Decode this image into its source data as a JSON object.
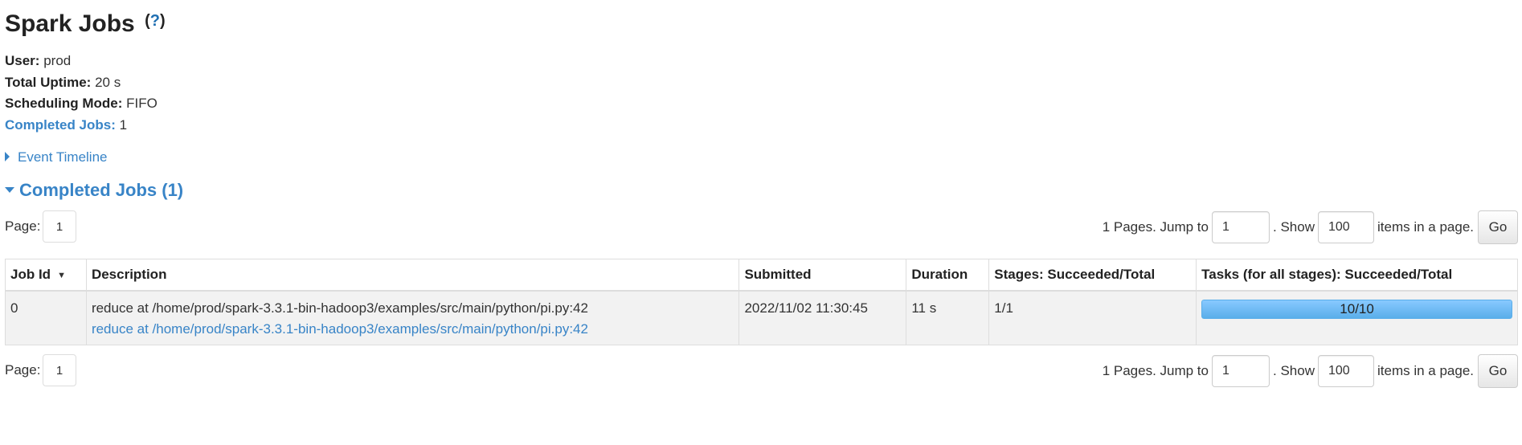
{
  "header": {
    "title": "Spark Jobs",
    "help_open": "(",
    "help_q": "?",
    "help_close": ")"
  },
  "summary": {
    "user_label": "User:",
    "user_value": "prod",
    "uptime_label": "Total Uptime:",
    "uptime_value": "20 s",
    "scheduling_label": "Scheduling Mode:",
    "scheduling_value": "FIFO",
    "completed_label": "Completed Jobs:",
    "completed_value": "1"
  },
  "event_timeline": "Event Timeline",
  "completed_section": "Completed Jobs (1)",
  "pager": {
    "page_label": "Page:",
    "page_current": "1",
    "pages_text": "1 Pages. Jump to",
    "jump_value": "1",
    "show_text": ". Show",
    "show_value": "100",
    "items_text": "items in a page.",
    "go_label": "Go"
  },
  "table": {
    "columns": [
      "Job Id",
      "Description",
      "Submitted",
      "Duration",
      "Stages: Succeeded/Total",
      "Tasks (for all stages): Succeeded/Total"
    ],
    "sort_indicator": "▼",
    "rows": [
      {
        "job_id": "0",
        "desc_main": "reduce at /home/prod/spark-3.3.1-bin-hadoop3/examples/src/main/python/pi.py:42",
        "desc_link": "reduce at /home/prod/spark-3.3.1-bin-hadoop3/examples/src/main/python/pi.py:42",
        "submitted": "2022/11/02 11:30:45",
        "duration": "11 s",
        "stages": "1/1",
        "tasks_label": "10/10",
        "tasks_progress": 1.0
      }
    ]
  },
  "colors": {
    "link": "#3884c7",
    "progress_fill": "#5aaeea",
    "row_bg": "#f2f2f2"
  }
}
